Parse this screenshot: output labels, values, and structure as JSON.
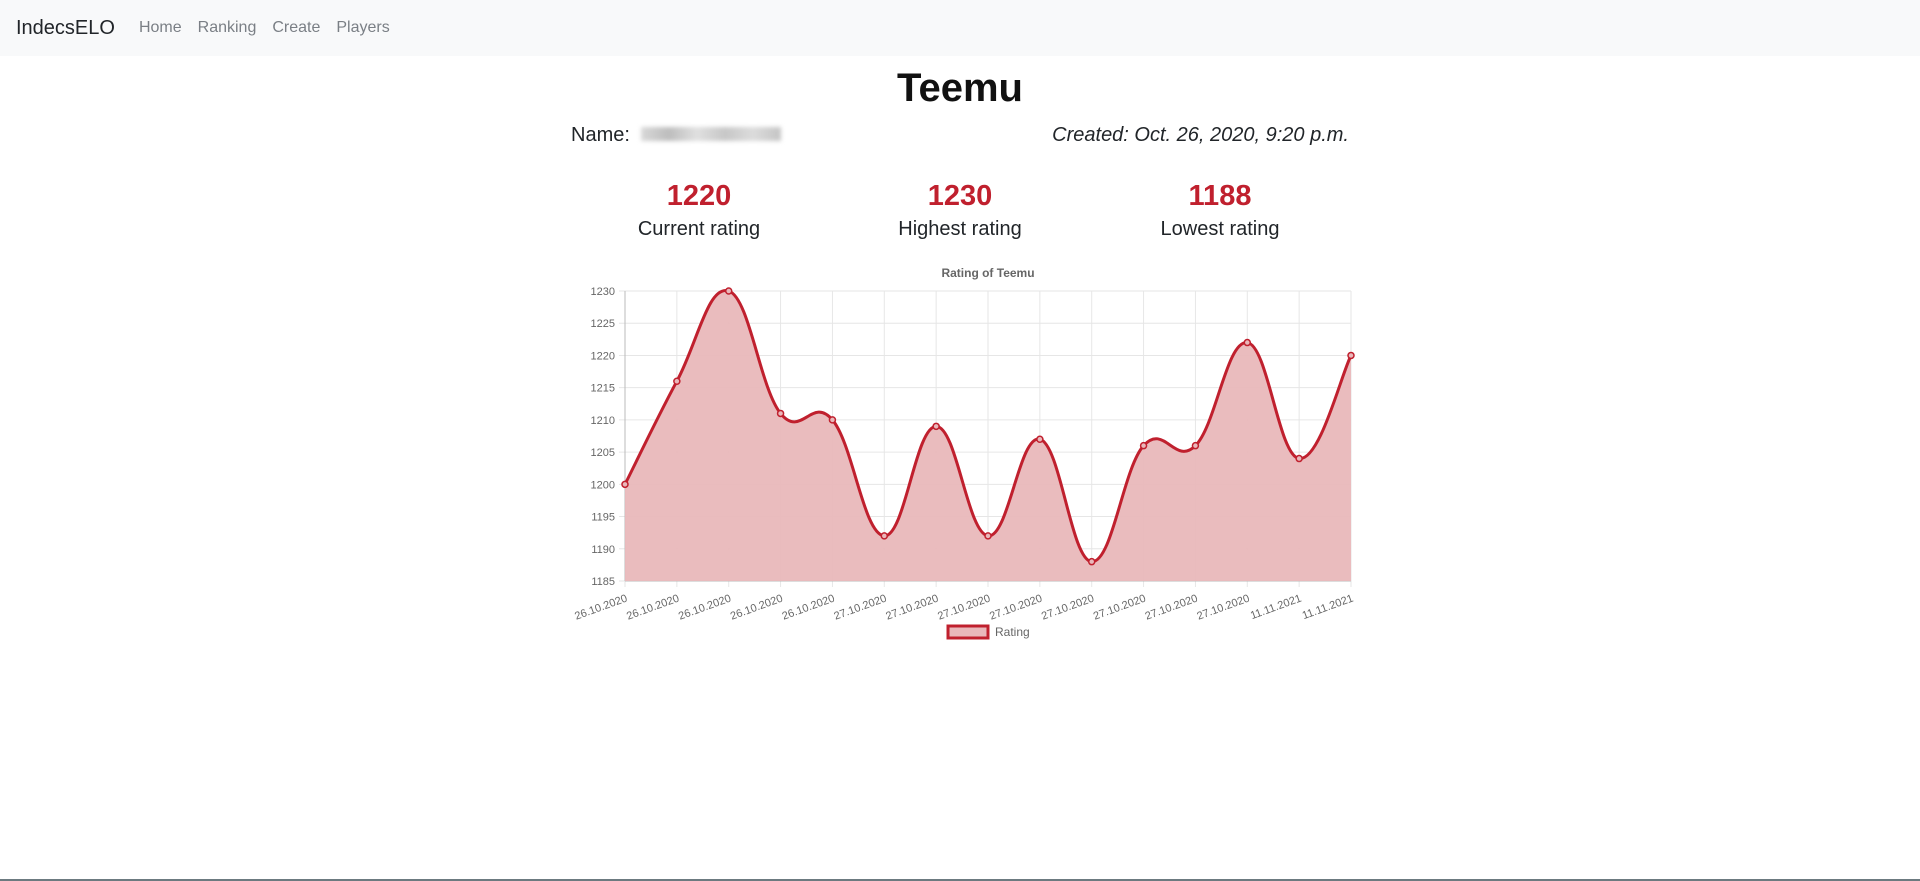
{
  "nav": {
    "brand": "IndecsELO",
    "links": [
      "Home",
      "Ranking",
      "Create",
      "Players"
    ]
  },
  "player": {
    "title": "Teemu",
    "name_label": "Name:",
    "created": "Created: Oct. 26, 2020, 9:20 p.m."
  },
  "stats": [
    {
      "value": "1220",
      "label": "Current rating"
    },
    {
      "value": "1230",
      "label": "Highest rating"
    },
    {
      "value": "1188",
      "label": "Lowest rating"
    }
  ],
  "colors": {
    "accent": "#c0202e",
    "fill": "#e9b8bb",
    "grid": "#e6e6e6"
  },
  "chart_data": {
    "type": "area",
    "title": "Rating of Teemu",
    "categories": [
      "26.10.2020",
      "26.10.2020",
      "26.10.2020",
      "26.10.2020",
      "26.10.2020",
      "27.10.2020",
      "27.10.2020",
      "27.10.2020",
      "27.10.2020",
      "27.10.2020",
      "27.10.2020",
      "27.10.2020",
      "27.10.2020",
      "11.11.2021",
      "11.11.2021"
    ],
    "series": [
      {
        "name": "Rating",
        "values": [
          1200,
          1216,
          1230,
          1211,
          1210,
          1192,
          1209,
          1192,
          1207,
          1188,
          1206,
          1206,
          1222,
          1204,
          1220
        ]
      }
    ],
    "ylim": [
      1185,
      1230
    ],
    "yticks": [
      1185,
      1190,
      1195,
      1200,
      1205,
      1210,
      1215,
      1220,
      1225,
      1230
    ],
    "grid": true,
    "legend": "bottom"
  }
}
